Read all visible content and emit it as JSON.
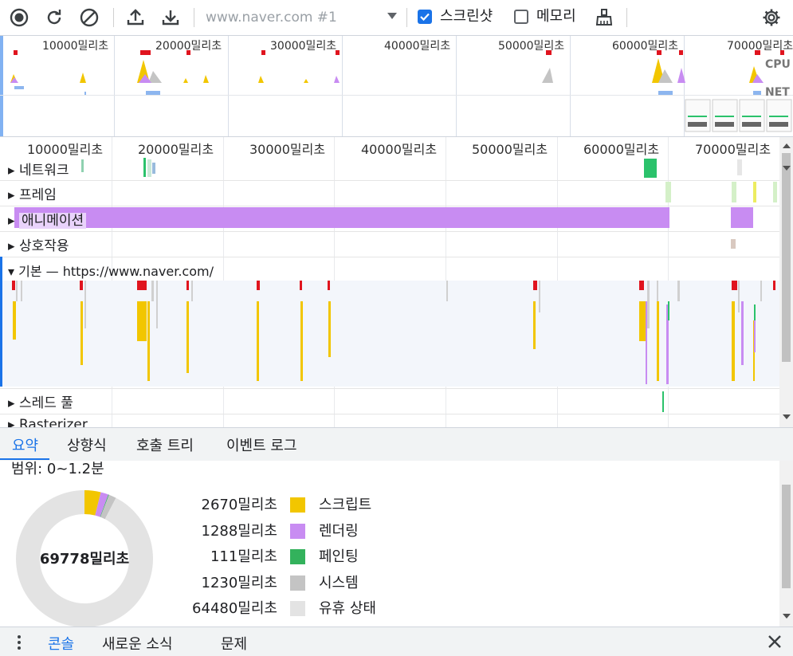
{
  "toolbar": {
    "url_placeholder": "www.naver.com #1",
    "screenshot_label": "스크린샷",
    "screenshot_checked": true,
    "memory_label": "메모리",
    "memory_checked": false
  },
  "overview": {
    "ticks": [
      "10000밀리초",
      "20000밀리초",
      "30000밀리초",
      "40000밀리초",
      "50000밀리초",
      "60000밀리초",
      "70000밀리초"
    ],
    "cpu_label": "CPU",
    "net_label": "NET"
  },
  "ruler": {
    "ticks": [
      "10000밀리초",
      "20000밀리초",
      "30000밀리초",
      "40000밀리초",
      "50000밀리초",
      "60000밀리초",
      "70000밀리초"
    ]
  },
  "tracks": {
    "network": "네트워크",
    "frames": "프레임",
    "animations": "애니메이션",
    "interactions": "상호작용",
    "main": "기본 — https://www.naver.com/",
    "thread_pool": "스레드 풀",
    "next": "Rasterizer"
  },
  "bottom_tabs": [
    "요약",
    "상향식",
    "호출 트리",
    "이벤트 로그"
  ],
  "summary": {
    "range": "범위: 0~1.2분",
    "total": "69778밀리초",
    "rows": [
      {
        "value": "2670밀리초",
        "name": "스크립트",
        "color": "#f2c600"
      },
      {
        "value": "1288밀리초",
        "name": "렌더링",
        "color": "#c88cf2"
      },
      {
        "value": "111밀리초",
        "name": "페인팅",
        "color": "#33b25c"
      },
      {
        "value": "1230밀리초",
        "name": "시스템",
        "color": "#c4c4c4"
      },
      {
        "value": "64480밀리초",
        "name": "유휴 상태",
        "color": "#e3e3e3"
      }
    ],
    "scripting_ms": 2670,
    "rendering_ms": 1288,
    "painting_ms": 111,
    "system_ms": 1230,
    "idle_ms": 64480
  },
  "drawer": {
    "console": "콘솔",
    "whats_new": "새로운 소식",
    "issues": "문제"
  }
}
